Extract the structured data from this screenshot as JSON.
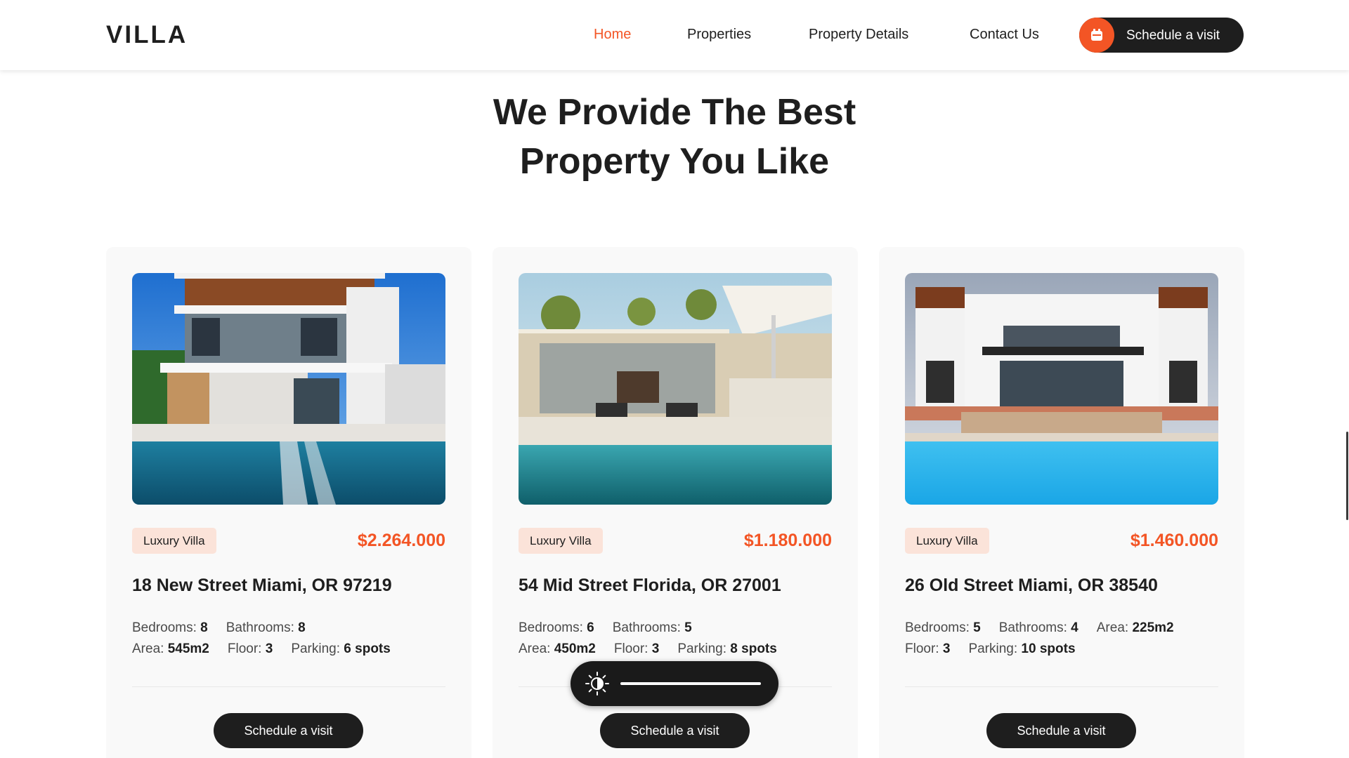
{
  "header": {
    "logo": "VILLA",
    "nav": [
      {
        "label": "Home",
        "active": true
      },
      {
        "label": "Properties",
        "active": false
      },
      {
        "label": "Property Details",
        "active": false
      },
      {
        "label": "Contact Us",
        "active": false
      }
    ],
    "schedule_button": {
      "label": "Schedule a visit",
      "icon": "calendar-icon"
    }
  },
  "main": {
    "heading_line1": "We Provide The Best",
    "heading_line2": "Property You Like"
  },
  "properties": [
    {
      "category": "Luxury Villa",
      "price": "$2.264.000",
      "address": "18 New Street Miami, OR 97219",
      "specs": [
        {
          "label": "Bedrooms: ",
          "value": "8"
        },
        {
          "label": "Bathrooms: ",
          "value": "8"
        },
        {
          "label": "Area: ",
          "value": "545m2"
        },
        {
          "label": "Floor: ",
          "value": "3"
        },
        {
          "label": "Parking: ",
          "value": "6 spots"
        }
      ],
      "button": "Schedule a visit"
    },
    {
      "category": "Luxury Villa",
      "price": "$1.180.000",
      "address": "54 Mid Street Florida, OR 27001",
      "specs": [
        {
          "label": "Bedrooms: ",
          "value": "6"
        },
        {
          "label": "Bathrooms: ",
          "value": "5"
        },
        {
          "label": "Area: ",
          "value": "450m2"
        },
        {
          "label": "Floor: ",
          "value": "3"
        },
        {
          "label": "Parking: ",
          "value": "8 spots"
        }
      ],
      "button": "Schedule a visit"
    },
    {
      "category": "Luxury Villa",
      "price": "$1.460.000",
      "address": "26 Old Street Miami, OR 38540",
      "specs": [
        {
          "label": "Bedrooms: ",
          "value": "5"
        },
        {
          "label": "Bathrooms: ",
          "value": "4"
        },
        {
          "label": "Area: ",
          "value": "225m2"
        },
        {
          "label": "Floor: ",
          "value": "3"
        },
        {
          "label": "Parking: ",
          "value": "10 spots"
        }
      ],
      "button": "Schedule a visit"
    }
  ],
  "overlay": {
    "brightness_icon": "brightness-icon",
    "brightness_level": 1.0
  },
  "colors": {
    "accent": "#f35525",
    "dark": "#1e1e1e",
    "tag_bg": "#fbe3d9",
    "card_bg": "#f9f9f9"
  }
}
